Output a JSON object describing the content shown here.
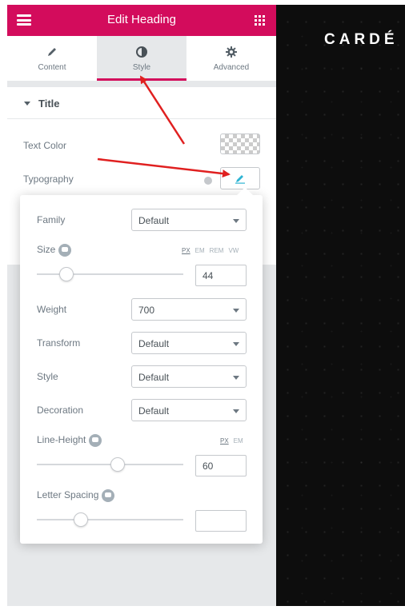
{
  "header": {
    "title": "Edit Heading",
    "menu_icon": "hamburger-icon",
    "apps_icon": "grid-icon"
  },
  "tabs": [
    {
      "label": "Content",
      "icon": "pencil-icon",
      "active": false
    },
    {
      "label": "Style",
      "icon": "half-circle-icon",
      "active": true
    },
    {
      "label": "Advanced",
      "icon": "gear-icon",
      "active": false
    }
  ],
  "section": {
    "title": "Title",
    "text_color_label": "Text Color",
    "typography_label": "Typography"
  },
  "typography": {
    "family": {
      "label": "Family",
      "value": "Default"
    },
    "size": {
      "label": "Size",
      "units": [
        "PX",
        "EM",
        "REM",
        "VW"
      ],
      "active_unit": "PX",
      "value": "44",
      "slider_fraction": 0.2
    },
    "weight": {
      "label": "Weight",
      "value": "700"
    },
    "transform": {
      "label": "Transform",
      "value": "Default"
    },
    "style": {
      "label": "Style",
      "value": "Default"
    },
    "decoration": {
      "label": "Decoration",
      "value": "Default"
    },
    "line_height": {
      "label": "Line-Height",
      "units": [
        "PX",
        "EM"
      ],
      "active_unit": "PX",
      "value": "60",
      "slider_fraction": 0.55
    },
    "letter_spacing": {
      "label": "Letter Spacing",
      "value": "",
      "slider_fraction": 0.3
    }
  },
  "preview": {
    "brand_text": "CARDÉ"
  },
  "colors": {
    "accent": "#d30c5c",
    "annotation_arrow": "#e02020",
    "preview_bg": "#0d0d0d"
  }
}
